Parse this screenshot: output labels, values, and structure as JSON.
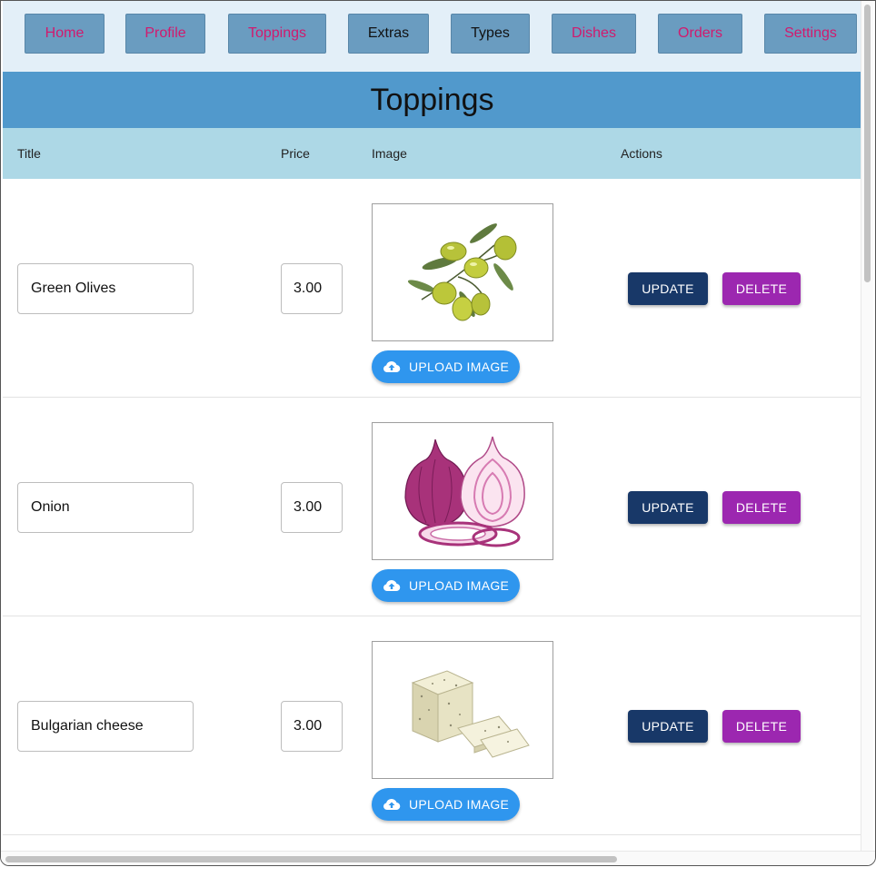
{
  "nav": {
    "items": [
      {
        "label": "Home",
        "style": "pink"
      },
      {
        "label": "Profile",
        "style": "pink"
      },
      {
        "label": "Toppings",
        "style": "pink"
      },
      {
        "label": "Extras",
        "style": "dark"
      },
      {
        "label": "Types",
        "style": "dark"
      },
      {
        "label": "Dishes",
        "style": "pink"
      },
      {
        "label": "Orders",
        "style": "pink"
      },
      {
        "label": "Settings",
        "style": "pink"
      }
    ]
  },
  "page": {
    "title": "Toppings"
  },
  "table": {
    "headers": {
      "title": "Title",
      "price": "Price",
      "image": "Image",
      "actions": "Actions"
    },
    "rows": [
      {
        "title": "Green Olives",
        "price": "3.00",
        "image": "green-olives-image"
      },
      {
        "title": "Onion",
        "price": "3.00",
        "image": "red-onion-image"
      },
      {
        "title": "Bulgarian cheese",
        "price": "3.00",
        "image": "bulgarian-cheese-image"
      }
    ],
    "upload_label": "UPLOAD IMAGE",
    "update_label": "UPDATE",
    "delete_label": "DELETE"
  },
  "colors": {
    "nav_bg": "#e3eff8",
    "nav_button": "#6a9cc0",
    "nav_link": "#d11a6e",
    "title_bar": "#5199cc",
    "table_header": "#add8e6",
    "upload": "#2f96ee",
    "update": "#183868",
    "delete": "#9c27b0"
  }
}
